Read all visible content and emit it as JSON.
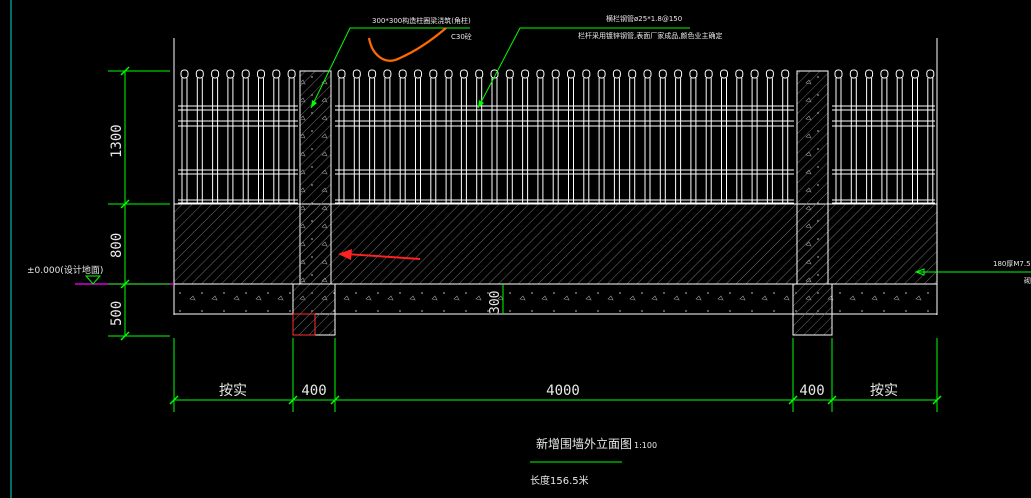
{
  "annotations": {
    "column_callout": "300*300构造柱圈梁浇筑(角柱)",
    "column_concrete": "C30砼",
    "railing_callout": "横栏钢管ø25*1.8@150",
    "railing_callout_note": "栏杆采用镀锌钢管,表面厂家成品,颜色业主确定",
    "ground_level": "±0.000(设计地面)",
    "wall_note_right_1": "180厚M7.5",
    "wall_note_right_2": "砌"
  },
  "dimensions": {
    "vertical": [
      "1300",
      "800",
      "500"
    ],
    "footing_depth": "300",
    "horizontal": [
      "按实",
      "400",
      "4000",
      "400",
      "按实"
    ]
  },
  "title": {
    "main": "新增围墙外立面图",
    "scale": "1:100",
    "length_note": "长度156.5米"
  },
  "colors": {
    "background": "#000000",
    "outline": "#ffffff",
    "dimension": "#00ff00",
    "hatch": "#8a8a8a",
    "ground_line": "#ff00ff",
    "markup_arrow": "#ff2020",
    "markup_scribble": "#ff6a00"
  }
}
